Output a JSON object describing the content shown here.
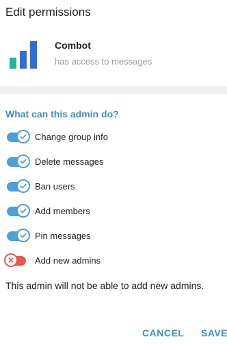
{
  "dialog": {
    "title": "Edit permissions"
  },
  "bot": {
    "name": "Combot",
    "status": "has access to messages"
  },
  "section": {
    "title": "What can this admin do?"
  },
  "permissions": [
    {
      "label": "Change group info",
      "enabled": true
    },
    {
      "label": "Delete messages",
      "enabled": true
    },
    {
      "label": "Ban users",
      "enabled": true
    },
    {
      "label": "Add members",
      "enabled": true
    },
    {
      "label": "Pin messages",
      "enabled": true
    },
    {
      "label": "Add new admins",
      "enabled": false
    }
  ],
  "note": "This admin will not be able to add new admins.",
  "buttons": {
    "cancel": "CANCEL",
    "save": "SAVE"
  },
  "colors": {
    "accent": "#4ca0d7",
    "off": "#e5594f",
    "bars": [
      "#1fb5a0",
      "#2d6fd6",
      "#2d6fd6"
    ]
  }
}
